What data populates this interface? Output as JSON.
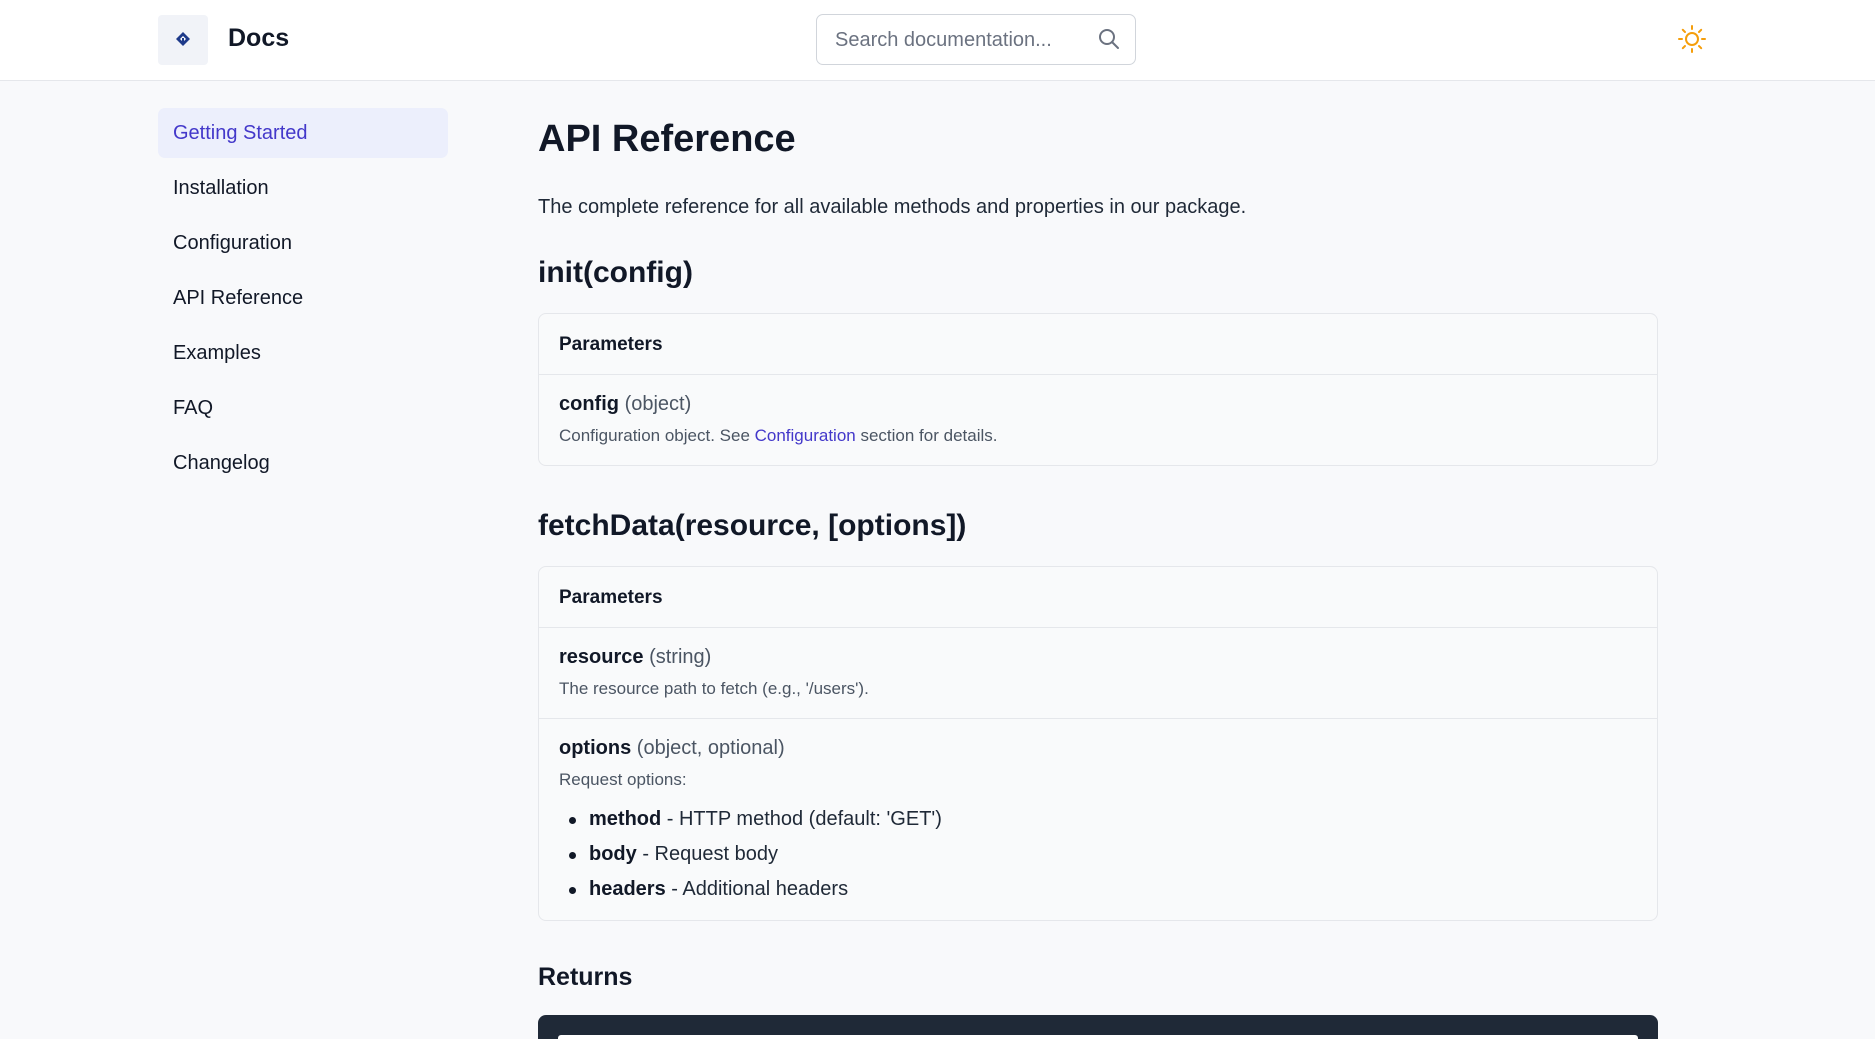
{
  "header": {
    "brand": "Docs",
    "logo_icon": "diamond-logo-icon",
    "search_placeholder": "Search documentation...",
    "search_icon": "search-icon",
    "theme_icon": "sun-icon",
    "theme_color": "#f59e0b"
  },
  "sidebar": {
    "items": [
      {
        "label": "Getting Started",
        "active": true
      },
      {
        "label": "Installation"
      },
      {
        "label": "Configuration"
      },
      {
        "label": "API Reference"
      },
      {
        "label": "Examples"
      },
      {
        "label": "FAQ"
      },
      {
        "label": "Changelog"
      }
    ]
  },
  "main": {
    "title": "API Reference",
    "intro": "The complete reference for all available methods and properties in our package.",
    "methods": [
      {
        "signature": "init(config)",
        "params_header": "Parameters",
        "params": [
          {
            "name": "config",
            "type": "(object)",
            "desc_before": "Configuration object. See ",
            "desc_link": "Configuration",
            "desc_after": " section for details."
          }
        ]
      },
      {
        "signature": "fetchData(resource, [options])",
        "params_header": "Parameters",
        "params": [
          {
            "name": "resource",
            "type": "(string)",
            "desc": "The resource path to fetch (e.g., '/users')."
          },
          {
            "name": "options",
            "type": "(object, optional)",
            "desc": "Request options:",
            "options": [
              {
                "key": "method",
                "text": " - HTTP method (default: 'GET')"
              },
              {
                "key": "body",
                "text": " - Request body"
              },
              {
                "key": "headers",
                "text": " - Additional headers"
              }
            ]
          }
        ]
      }
    ],
    "returns_heading": "Returns"
  },
  "colors": {
    "accent": "#4338ca",
    "active_bg": "#eceffc",
    "code_bg": "#1f2937"
  }
}
